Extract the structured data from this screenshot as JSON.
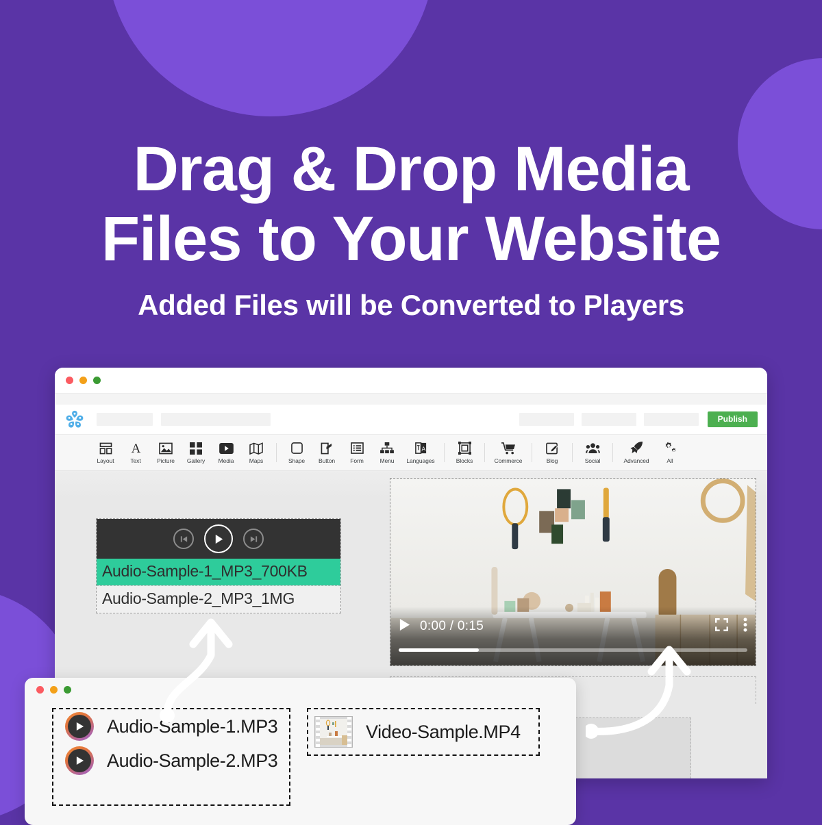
{
  "theme": {
    "bg_purple": "#5A34A6",
    "circle_purple": "#7B4FD8",
    "accent_green": "#4CAF50",
    "audio_highlight": "#2ECC9B",
    "canvas_gray": "#E8E8E8"
  },
  "hero": {
    "headline_line1": "Drag & Drop Media",
    "headline_line2": "Files to Your Website",
    "subheadline": "Added Files will be Converted to Players"
  },
  "builder_window": {
    "traffic_lights": [
      "close-red",
      "minimize-amber",
      "maximize-green"
    ],
    "logo": "site-builder-logo",
    "header_placeholders": [
      "",
      "",
      "",
      "",
      ""
    ],
    "publish_label": "Publish",
    "toolbar": {
      "items": [
        {
          "label": "Layout",
          "icon": "layout-icon"
        },
        {
          "label": "Text",
          "icon": "text-icon"
        },
        {
          "label": "Picture",
          "icon": "picture-icon"
        },
        {
          "label": "Gallery",
          "icon": "gallery-icon"
        },
        {
          "label": "Media",
          "icon": "media-icon"
        },
        {
          "label": "Maps",
          "icon": "maps-icon"
        },
        {
          "label": "Shape",
          "icon": "shape-icon"
        },
        {
          "label": "Button",
          "icon": "button-icon"
        },
        {
          "label": "Form",
          "icon": "form-icon"
        },
        {
          "label": "Menu",
          "icon": "menu-icon"
        },
        {
          "label": "Languages",
          "icon": "languages-icon"
        },
        {
          "label": "Blocks",
          "icon": "blocks-icon"
        },
        {
          "label": "Commerce",
          "icon": "commerce-icon"
        },
        {
          "label": "Blog",
          "icon": "blog-icon"
        },
        {
          "label": "Social",
          "icon": "social-icon"
        },
        {
          "label": "Advanced",
          "icon": "advanced-icon"
        },
        {
          "label": "All",
          "icon": "all-icon"
        }
      ]
    }
  },
  "audio_player_widget": {
    "controls": [
      "previous-track",
      "play",
      "next-track"
    ],
    "tracks": [
      {
        "name": "Audio-Sample-1_MP3_700KB",
        "active": true
      },
      {
        "name": "Audio-Sample-2_MP3_1MG",
        "active": false
      }
    ]
  },
  "video_player_widget": {
    "play_state": "paused",
    "time_display": "0:00 / 0:15",
    "current_time": "0:00",
    "duration": "0:15",
    "progress_percent": 23,
    "controls": [
      "play",
      "fullscreen",
      "more-options"
    ]
  },
  "files_window": {
    "traffic_lights": [
      "close-red",
      "minimize-amber",
      "maximize-green"
    ],
    "audio_files": [
      {
        "name": "Audio-Sample-1.MP3",
        "icon": "audio-play-icon"
      },
      {
        "name": "Audio-Sample-2.MP3",
        "icon": "audio-play-icon"
      }
    ],
    "video_files": [
      {
        "name": "Video-Sample.MP4",
        "icon": "film-strip-icon"
      }
    ]
  },
  "arrows": [
    {
      "name": "drag-arrow-audio",
      "from": "audio-files-drop-zone",
      "to": "audio-player-widget"
    },
    {
      "name": "drag-arrow-video",
      "from": "video-file-drop-zone",
      "to": "video-player-widget"
    }
  ]
}
